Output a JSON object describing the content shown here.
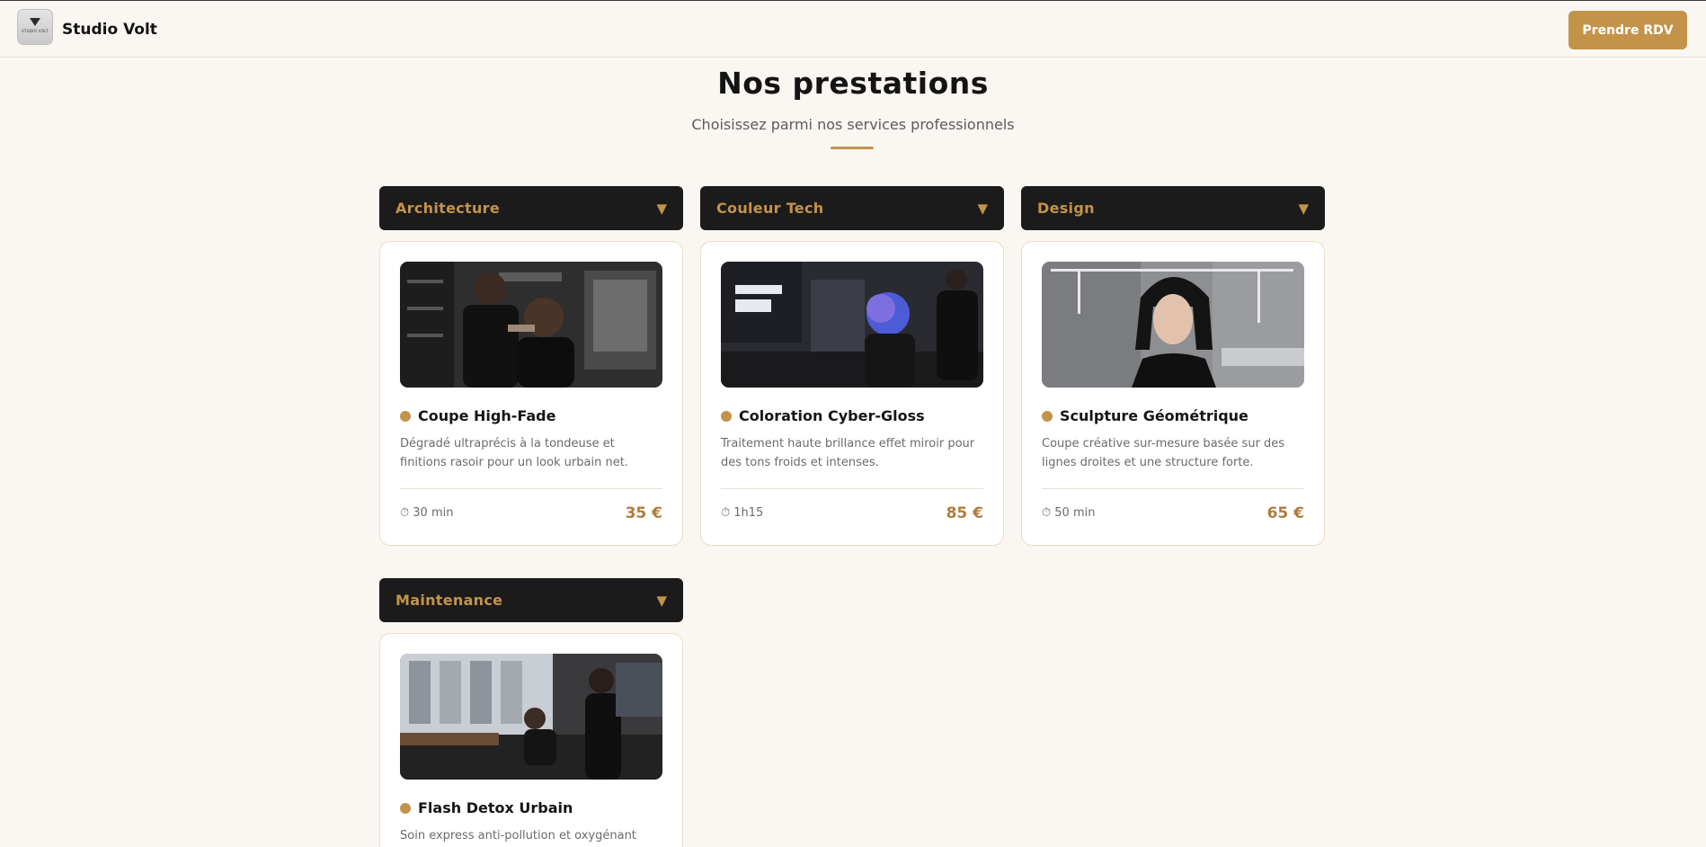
{
  "header": {
    "brand_name": "Studio Volt",
    "logo_text": "STUDIO VOLT",
    "cta_label": "Prendre RDV",
    "accent_color": "#c4934a"
  },
  "section": {
    "title": "Nos prestations",
    "subtitle": "Choisissez parmi nos services professionnels"
  },
  "categories": [
    {
      "name": "Architecture",
      "caret_icon": "triangle-down",
      "service": {
        "name": "Coupe High-Fade",
        "description": "Dégradé ultraprécis à la tondeuse et finitions rasoir pour un look urbain net.",
        "duration": "⏱ 30 min",
        "price": "35 €",
        "image": "barber-cutting-client-photo"
      }
    },
    {
      "name": "Couleur Tech",
      "caret_icon": "triangle-down",
      "service": {
        "name": "Coloration Cyber-Gloss",
        "description": "Traitement haute brillance effet miroir pour des tons froids et intenses.",
        "duration": "⏱ 1h15",
        "price": "85 €",
        "image": "blue-hair-coloring-photo"
      }
    },
    {
      "name": "Design",
      "caret_icon": "triangle-down",
      "service": {
        "name": "Sculpture Géométrique",
        "description": "Coupe créative sur-mesure basée sur des lignes droites et une structure forte.",
        "duration": "⏱ 50 min",
        "price": "65 €",
        "image": "geometric-bob-portrait-photo"
      }
    },
    {
      "name": "Maintenance",
      "caret_icon": "triangle-down",
      "service": {
        "name": "Flash Detox Urbain",
        "description": "Soin express anti-pollution et oxygénant pour",
        "image": "salon-interior-photo"
      }
    }
  ]
}
